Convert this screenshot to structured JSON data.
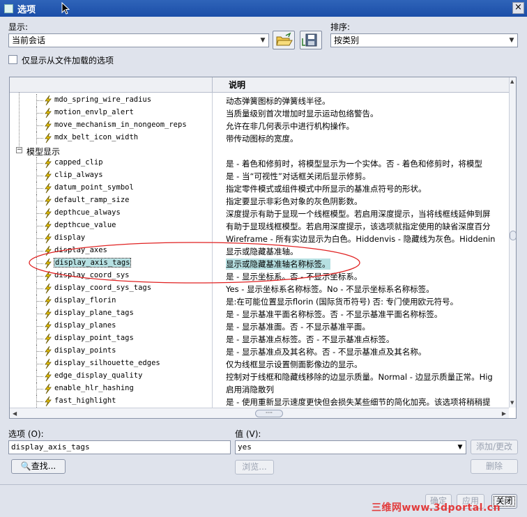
{
  "window": {
    "title": "选项"
  },
  "top": {
    "display_label": "显示:",
    "display_value": "当前会话",
    "sort_label": "排序:",
    "sort_value": "按类别",
    "checkbox_label": "仅显示从文件加载的选项"
  },
  "table": {
    "col_desc_header": "说明",
    "rows": [
      {
        "kind": "opt",
        "name": "mdo_spring_wire_radius",
        "desc": "动态弹簧图标的弹簧线半径。"
      },
      {
        "kind": "opt",
        "name": "motion_envlp_alert",
        "desc": "当质量级别首次增加时显示运动包络警告。"
      },
      {
        "kind": "opt",
        "name": "move_mechanism_in_nongeom_reps",
        "desc": "允许在非几何表示中进行机构操作。"
      },
      {
        "kind": "opt",
        "name": "mdx_belt_icon_width",
        "desc": "带传动图标的宽度。"
      },
      {
        "kind": "cat",
        "name": "模型显示",
        "desc": ""
      },
      {
        "kind": "opt",
        "name": "capped_clip",
        "desc": "是 - 着色和修剪时，将模型显示为一个实体。否 - 着色和修剪时，将模型"
      },
      {
        "kind": "opt",
        "name": "clip_always",
        "desc": "是 - 当“可视性”对话框关闭后显示修剪。"
      },
      {
        "kind": "opt",
        "name": "datum_point_symbol",
        "desc": "指定零件模式或组件模式中所显示的基准点符号的形状。"
      },
      {
        "kind": "opt",
        "name": "default_ramp_size",
        "desc": "指定要显示非彩色对象的灰色阴影数。"
      },
      {
        "kind": "opt",
        "name": "depthcue_always",
        "desc": "深度提示有助于显现一个线框模型。若启用深度提示，当将线框线延伸到屏"
      },
      {
        "kind": "opt",
        "name": "depthcue_value",
        "desc": "有助于显现线框模型。若启用深度提示，该选项就指定使用的缺省深度百分"
      },
      {
        "kind": "opt",
        "name": "display",
        "desc": "Wireframe - 所有实边显示为白色。Hiddenvis - 隐藏线为灰色。Hiddenin"
      },
      {
        "kind": "opt",
        "name": "display_axes",
        "desc": "显示或隐藏基准轴。"
      },
      {
        "kind": "opt",
        "name": "display_axis_tags",
        "desc": "显示或隐藏基准轴名称标签。",
        "selected": true
      },
      {
        "kind": "opt",
        "name": "display_coord_sys",
        "desc": "是 - 显示坐标系。否 - 不显示坐标系。"
      },
      {
        "kind": "opt",
        "name": "display_coord_sys_tags",
        "desc": "Yes - 显示坐标系名称标签。No - 不显示坐标系名称标签。"
      },
      {
        "kind": "opt",
        "name": "display_florin",
        "desc": "是:在可能位置显示florin (国际货币符号) 否: 专门使用欧元符号。"
      },
      {
        "kind": "opt",
        "name": "display_plane_tags",
        "desc": "是 - 显示基准平面名称标签。否 - 不显示基准平面名称标签。"
      },
      {
        "kind": "opt",
        "name": "display_planes",
        "desc": "是 - 显示基准面。否 - 不显示基准平面。"
      },
      {
        "kind": "opt",
        "name": "display_point_tags",
        "desc": "是 - 显示基准点标签。否 - 不显示基准点标签。"
      },
      {
        "kind": "opt",
        "name": "display_points",
        "desc": "是 - 显示基准点及其名称。否 - 不显示基准点及其名称。"
      },
      {
        "kind": "opt",
        "name": "display_silhouette_edges",
        "desc": "仅为线框显示设置侧面影像边的显示。"
      },
      {
        "kind": "opt",
        "name": "edge_display_quality",
        "desc": "控制对于线框和隐藏线移除的边显示质量。Normal - 边显示质量正常。Hig"
      },
      {
        "kind": "opt",
        "name": "enable_hlr_hashing",
        "desc": "启用消隐散列"
      },
      {
        "kind": "opt",
        "name": "fast_highlight",
        "desc": "是 - 使用重新显示速度更快但会损失某些细节的简化加亮。该选项将稍稍提"
      }
    ]
  },
  "bottom": {
    "option_label": "选项 (O):",
    "option_value": "display_axis_tags",
    "value_label": "值 (V):",
    "value_value": "yes",
    "find_button": "查找...",
    "browse_button": "浏览...",
    "add_change_button": "添加/更改",
    "delete_button": "删除"
  },
  "footer": {
    "ok_button": "确定",
    "apply_button": "应用",
    "close_button": "关闭",
    "watermark": "三维网www.3dportal.cn"
  },
  "colors": {
    "titlebar": "#1b4ea8",
    "selection": "#b6e0e2",
    "annotation_ellipse": "#e02020",
    "option_icon": "#e8c200"
  }
}
